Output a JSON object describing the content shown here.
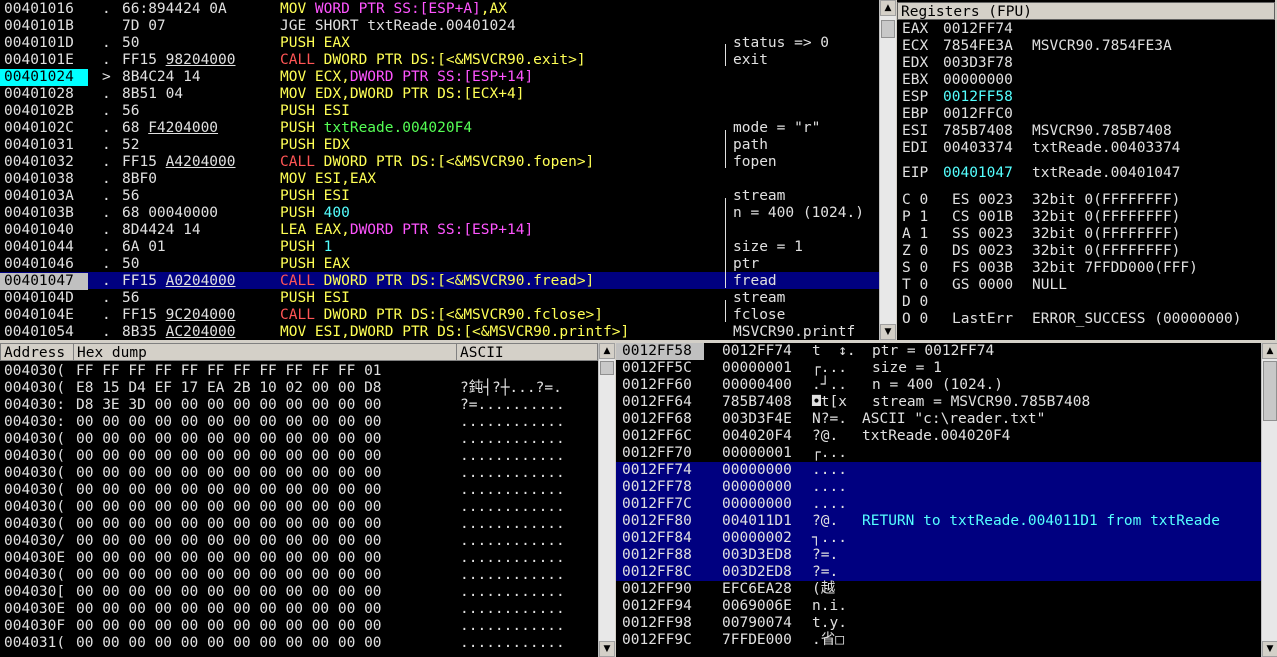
{
  "cpu": {
    "rows": [
      {
        "addr": "00401016",
        "mark": ".",
        "hex": "66:894424 0A",
        "hex_u": "",
        "ins": [
          [
            "y",
            "MOV "
          ],
          [
            "m",
            "WORD PTR SS:[ESP+A]"
          ],
          [
            "y",
            ",AX"
          ]
        ],
        "cmt": ""
      },
      {
        "addr": "0040101B",
        "mark": " ",
        "hex": "7D 07",
        "hex_u": "",
        "ins": [
          [
            "w",
            "JGE SHORT txtReade.00401024"
          ]
        ],
        "cmt": ""
      },
      {
        "addr": "0040101D",
        "mark": ".",
        "hex": "50",
        "hex_u": "",
        "ins": [
          [
            "y",
            "PUSH EAX"
          ]
        ],
        "cmt": "status => 0"
      },
      {
        "addr": "0040101E",
        "mark": ".",
        "hex": "FF15 ",
        "hex_u": "98204000",
        "ins": [
          [
            "r",
            "CALL "
          ],
          [
            "y",
            "DWORD PTR DS:[<&MSVCR90.exit>]"
          ]
        ],
        "cmt": "exit"
      },
      {
        "addr": "00401024",
        "mark": ">",
        "hex": "8B4C24 14",
        "hex_u": "",
        "ins": [
          [
            "y",
            "MOV ECX,"
          ],
          [
            "m",
            "DWORD PTR SS:[ESP+14]"
          ]
        ],
        "cmt": ""
      },
      {
        "addr": "00401028",
        "mark": ".",
        "hex": "8B51 04",
        "hex_u": "",
        "ins": [
          [
            "y",
            "MOV EDX,DWORD PTR DS:[ECX+4]"
          ]
        ],
        "cmt": ""
      },
      {
        "addr": "0040102B",
        "mark": ".",
        "hex": "56",
        "hex_u": "",
        "ins": [
          [
            "y",
            "PUSH ESI"
          ]
        ],
        "cmt": ""
      },
      {
        "addr": "0040102C",
        "mark": ".",
        "hex": "68 ",
        "hex_u": "F4204000",
        "ins": [
          [
            "y",
            "PUSH "
          ],
          [
            "g",
            "txtReade.004020F4"
          ]
        ],
        "cmt": "mode = \"r\""
      },
      {
        "addr": "00401031",
        "mark": ".",
        "hex": "52",
        "hex_u": "",
        "ins": [
          [
            "y",
            "PUSH EDX"
          ]
        ],
        "cmt": "path"
      },
      {
        "addr": "00401032",
        "mark": ".",
        "hex": "FF15 ",
        "hex_u": "A4204000",
        "ins": [
          [
            "r",
            "CALL "
          ],
          [
            "y",
            "DWORD PTR DS:[<&MSVCR90.fopen>]"
          ]
        ],
        "cmt": "fopen"
      },
      {
        "addr": "00401038",
        "mark": ".",
        "hex": "8BF0",
        "hex_u": "",
        "ins": [
          [
            "y",
            "MOV ESI,EAX"
          ]
        ],
        "cmt": ""
      },
      {
        "addr": "0040103A",
        "mark": ".",
        "hex": "56",
        "hex_u": "",
        "ins": [
          [
            "y",
            "PUSH ESI"
          ]
        ],
        "cmt": "stream"
      },
      {
        "addr": "0040103B",
        "mark": ".",
        "hex": "68 00040000",
        "hex_u": "",
        "ins": [
          [
            "y",
            "PUSH "
          ],
          [
            "cy",
            "400"
          ]
        ],
        "cmt": "n = 400 (1024.)"
      },
      {
        "addr": "00401040",
        "mark": ".",
        "hex": "8D4424 14",
        "hex_u": "",
        "ins": [
          [
            "y",
            "LEA EAX,"
          ],
          [
            "m",
            "DWORD PTR SS:[ESP+14]"
          ]
        ],
        "cmt": ""
      },
      {
        "addr": "00401044",
        "mark": ".",
        "hex": "6A 01",
        "hex_u": "",
        "ins": [
          [
            "y",
            "PUSH "
          ],
          [
            "cy",
            "1"
          ]
        ],
        "cmt": "size = 1"
      },
      {
        "addr": "00401046",
        "mark": ".",
        "hex": "50",
        "hex_u": "",
        "ins": [
          [
            "y",
            "PUSH EAX"
          ]
        ],
        "cmt": "ptr"
      },
      {
        "addr": "00401047",
        "mark": ".",
        "hex": "FF15 ",
        "hex_u": "A0204000",
        "ins": [
          [
            "r",
            "CALL "
          ],
          [
            "y",
            "DWORD PTR DS:[<&MSVCR90.fread>]"
          ]
        ],
        "cmt": "fread"
      },
      {
        "addr": "0040104D",
        "mark": ".",
        "hex": "56",
        "hex_u": "",
        "ins": [
          [
            "y",
            "PUSH ESI"
          ]
        ],
        "cmt": "stream"
      },
      {
        "addr": "0040104E",
        "mark": ".",
        "hex": "FF15 ",
        "hex_u": "9C204000",
        "ins": [
          [
            "r",
            "CALL "
          ],
          [
            "y",
            "DWORD PTR DS:[<&MSVCR90.fclose>]"
          ]
        ],
        "cmt": "fclose"
      },
      {
        "addr": "00401054",
        "mark": ".",
        "hex": "8B35 ",
        "hex_u": "AC204000",
        "ins": [
          [
            "y",
            "MOV ESI,DWORD PTR DS:[<&MSVCR90.printf>]"
          ]
        ],
        "cmt": "MSVCR90.printf"
      }
    ]
  },
  "registers": {
    "title": "Registers (FPU)",
    "gp": [
      [
        "EAX",
        "0012FF74",
        ""
      ],
      [
        "ECX",
        "7854FE3A",
        "MSVCR90.7854FE3A"
      ],
      [
        "EDX",
        "003D3F78",
        ""
      ],
      [
        "EBX",
        "00000000",
        ""
      ],
      [
        "ESP",
        "0012FF58",
        ""
      ],
      [
        "EBP",
        "0012FFC0",
        ""
      ],
      [
        "ESI",
        "785B7408",
        "MSVCR90.785B7408"
      ],
      [
        "EDI",
        "00403374",
        "txtReade.00403374"
      ]
    ],
    "eip": [
      "EIP",
      "00401047",
      "txtReade.00401047"
    ],
    "flags": [
      [
        "C 0",
        "ES 0023",
        "32bit 0(FFFFFFFF)"
      ],
      [
        "P 1",
        "CS 001B",
        "32bit 0(FFFFFFFF)"
      ],
      [
        "A 1",
        "SS 0023",
        "32bit 0(FFFFFFFF)"
      ],
      [
        "Z 0",
        "DS 0023",
        "32bit 0(FFFFFFFF)"
      ],
      [
        "S 0",
        "FS 003B",
        "32bit 7FFDD000(FFF)"
      ],
      [
        "T 0",
        "GS 0000",
        "NULL"
      ],
      [
        "D 0",
        "",
        ""
      ],
      [
        "O 0",
        "LastErr",
        "ERROR_SUCCESS (00000000)"
      ]
    ]
  },
  "dump": {
    "col_address": "Address",
    "col_hex": "Hex dump",
    "col_ascii": "ASCII",
    "rows": [
      [
        "004030(",
        "FF FF FF FF FF FF FF FF FF FF FF 01",
        ""
      ],
      [
        "004030(",
        "E8 15 D4 EF 17 EA 2B 10 02 00 00 D8",
        "?鈍┤?┼...?=."
      ],
      [
        "004030:",
        "D8 3E 3D 00 00 00 00 00 00 00 00 00",
        "?=.........."
      ],
      [
        "004030:",
        "00 00 00 00 00 00 00 00 00 00 00 00",
        "............"
      ],
      [
        "004030(",
        "00 00 00 00 00 00 00 00 00 00 00 00",
        "............"
      ],
      [
        "004030(",
        "00 00 00 00 00 00 00 00 00 00 00 00",
        "............"
      ],
      [
        "004030(",
        "00 00 00 00 00 00 00 00 00 00 00 00",
        "............"
      ],
      [
        "004030(",
        "00 00 00 00 00 00 00 00 00 00 00 00",
        "............"
      ],
      [
        "004030(",
        "00 00 00 00 00 00 00 00 00 00 00 00",
        "............"
      ],
      [
        "004030(",
        "00 00 00 00 00 00 00 00 00 00 00 00",
        "............"
      ],
      [
        "004030/",
        "00 00 00 00 00 00 00 00 00 00 00 00",
        "............"
      ],
      [
        "004030E",
        "00 00 00 00 00 00 00 00 00 00 00 00",
        "............"
      ],
      [
        "004030(",
        "00 00 00 00 00 00 00 00 00 00 00 00",
        "............"
      ],
      [
        "004030[",
        "00 00 00 00 00 00 00 00 00 00 00 00",
        "............"
      ],
      [
        "004030E",
        "00 00 00 00 00 00 00 00 00 00 00 00",
        "............"
      ],
      [
        "004030F",
        "00 00 00 00 00 00 00 00 00 00 00 00",
        "............"
      ],
      [
        "004031(",
        "00 00 00 00 00 00 00 00 00 00 00 00",
        "............"
      ]
    ]
  },
  "stack": {
    "rows": [
      [
        "0012FF58",
        "0012FF74",
        "t  ↕.",
        "ptr = 0012FF74"
      ],
      [
        "0012FF5C",
        "00000001",
        "┌...",
        "size = 1"
      ],
      [
        "0012FF60",
        "00000400",
        ".┘..",
        "n = 400 (1024.)"
      ],
      [
        "0012FF64",
        "785B7408",
        "◘t[x",
        "stream = MSVCR90.785B7408"
      ],
      [
        "0012FF68",
        "003D3F4E",
        "N?=.",
        "ASCII \"c:\\reader.txt\""
      ],
      [
        "0012FF6C",
        "004020F4",
        "?@.",
        "txtReade.004020F4"
      ],
      [
        "0012FF70",
        "00000001",
        "┌...",
        ""
      ],
      [
        "0012FF74",
        "00000000",
        "....",
        ""
      ],
      [
        "0012FF78",
        "00000000",
        "....",
        ""
      ],
      [
        "0012FF7C",
        "00000000",
        "....",
        ""
      ],
      [
        "0012FF80",
        "004011D1",
        "?@.",
        "RETURN to txtReade.004011D1 from txtReade"
      ],
      [
        "0012FF84",
        "00000002",
        "┐...",
        ""
      ],
      [
        "0012FF88",
        "003D3ED8",
        "?=.",
        ""
      ],
      [
        "0012FF8C",
        "003D2ED8",
        "?=.",
        ""
      ],
      [
        "0012FF90",
        "EFC6EA28",
        "(越",
        ""
      ],
      [
        "0012FF94",
        "0069006E",
        "n.i.",
        ""
      ],
      [
        "0012FF98",
        "00790074",
        "t.y.",
        ""
      ],
      [
        "0012FF9C",
        "7FFDE000",
        ".省□",
        ""
      ]
    ]
  },
  "palette": {
    "selection": "#000080",
    "cur_addr_bg": "#00ffff",
    "fg": "#e0e0e0"
  }
}
